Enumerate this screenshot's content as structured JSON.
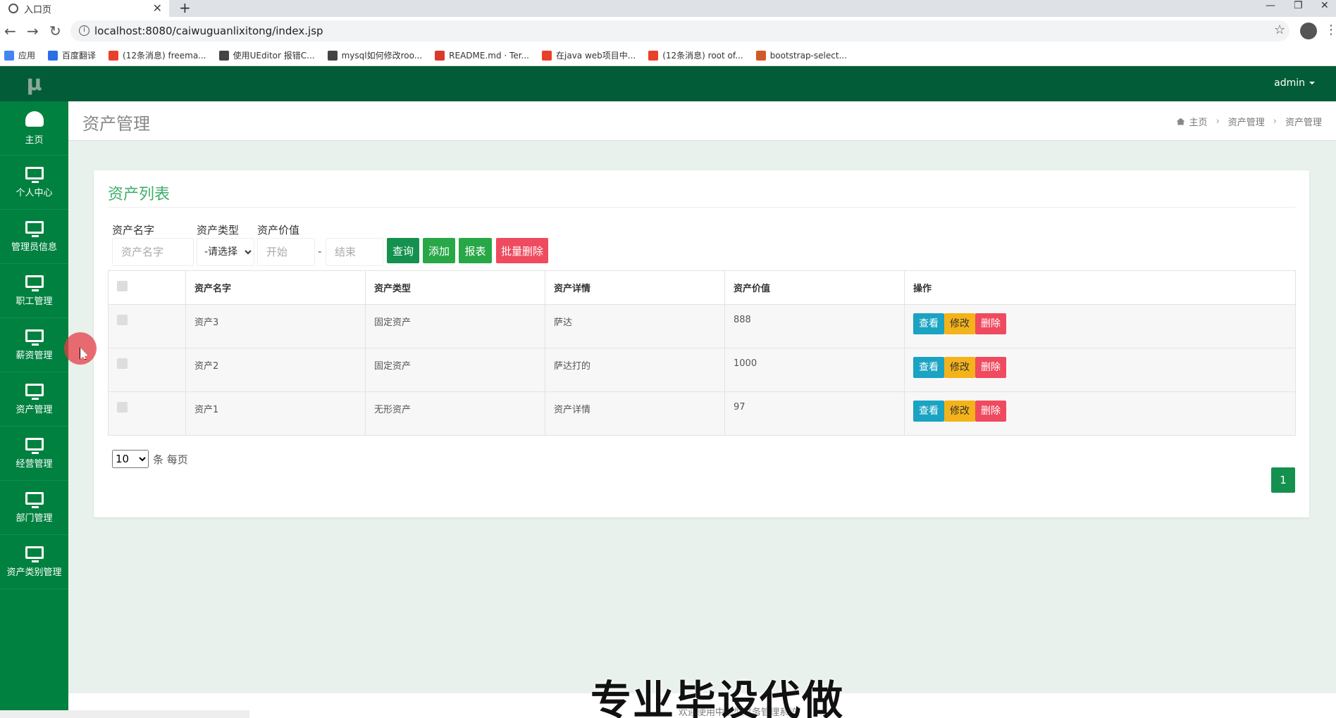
{
  "browser": {
    "tab_title": "入口页",
    "tab_close": "✕",
    "new_tab": "+",
    "url": "localhost:8080/caiwuguanlixitong/index.jsp",
    "controls": {
      "minimize": "—",
      "restore": "❐",
      "close": "✕"
    },
    "nav": {
      "back": "←",
      "forward": "→",
      "reload": "↻",
      "star": "☆",
      "menu": "⋮"
    },
    "bookmarks": [
      {
        "label": "应用",
        "color": "#4285f4"
      },
      {
        "label": "百度翻译",
        "color": "#2a6ee8"
      },
      {
        "label": "(12条消息) freema...",
        "color": "#e8402a"
      },
      {
        "label": "使用UEditor 报错C...",
        "color": "#444444"
      },
      {
        "label": "mysql如何修改roo...",
        "color": "#444444"
      },
      {
        "label": "README.md · Ter...",
        "color": "#d83a2c"
      },
      {
        "label": "在java web项目中...",
        "color": "#e8402a"
      },
      {
        "label": "(12条消息) root of...",
        "color": "#e8402a"
      },
      {
        "label": "bootstrap-select...",
        "color": "#d05a2a"
      }
    ]
  },
  "app": {
    "logo": "μ",
    "user": "admin",
    "sidebar": [
      {
        "label": "主页",
        "icon": "dashboard-icon"
      },
      {
        "label": "个人中心",
        "icon": "monitor-icon"
      },
      {
        "label": "管理员信息",
        "icon": "monitor-icon"
      },
      {
        "label": "职工管理",
        "icon": "monitor-icon"
      },
      {
        "label": "薪资管理",
        "icon": "monitor-icon"
      },
      {
        "label": "资产管理",
        "icon": "monitor-icon"
      },
      {
        "label": "经营管理",
        "icon": "monitor-icon"
      },
      {
        "label": "部门管理",
        "icon": "monitor-icon"
      },
      {
        "label": "资产类别管理",
        "icon": "monitor-icon"
      }
    ],
    "page_title": "资产管理",
    "breadcrumb": [
      "主页",
      "资产管理",
      "资产管理"
    ],
    "panel_title": "资产列表",
    "filters": {
      "name_label": "资产名字",
      "name_placeholder": "资产名字",
      "type_label": "资产类型",
      "type_selected": "-请选择-",
      "value_label": "资产价值",
      "value_start_placeholder": "开始",
      "value_end_placeholder": "结束",
      "range_sep": "-"
    },
    "buttons": {
      "search": "查询",
      "add": "添加",
      "report": "报表",
      "batch_delete": "批量删除"
    },
    "table": {
      "headers": [
        "资产名字",
        "资产类型",
        "资产详情",
        "资产价值",
        "操作"
      ],
      "rows": [
        {
          "name": "资产3",
          "type": "固定资产",
          "detail": "萨达",
          "value": "888"
        },
        {
          "name": "资产2",
          "type": "固定资产",
          "detail": "萨达打的",
          "value": "1000"
        },
        {
          "name": "资产1",
          "type": "无形资产",
          "detail": "资产详情",
          "value": "97"
        }
      ],
      "actions": {
        "view": "查看",
        "edit": "修改",
        "delete": "删除"
      }
    },
    "pagination": {
      "page_size": "10",
      "per_page_label": "条 每页",
      "current_page": "1"
    },
    "footer": "欢迎使用中小型财务管理系统"
  },
  "overlay": {
    "watermark": "专业毕设代做"
  },
  "colors": {
    "sidebar": "#00813f",
    "topbar": "#015c37",
    "accent": "#3fae6a",
    "content_bg": "#e8f1ec"
  }
}
